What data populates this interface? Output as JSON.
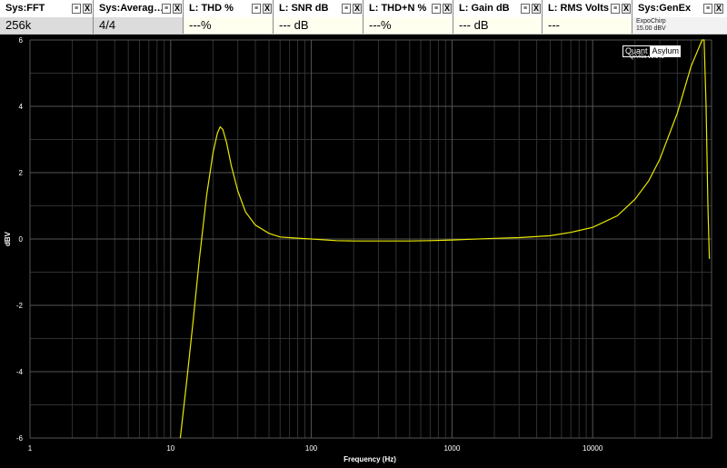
{
  "meters": [
    {
      "title": "Sys:FFT",
      "value": "256k",
      "kind": "sys"
    },
    {
      "title": "Sys:Averag…",
      "value": "4/4",
      "kind": "sys"
    },
    {
      "title": "L: THD %",
      "value": "---%",
      "kind": "lvl"
    },
    {
      "title": "L: SNR dB",
      "value": "--- dB",
      "kind": "lvl"
    },
    {
      "title": "L: THD+N %",
      "value": "---%",
      "kind": "lvl"
    },
    {
      "title": "L: Gain dB",
      "value": "--- dB",
      "kind": "lvl"
    },
    {
      "title": "L: RMS Volts",
      "value": "---",
      "kind": "lvl"
    }
  ],
  "generator": {
    "title": "Sys:GenEx",
    "line1": "ExpoChirp",
    "line2": "15.00 dBV"
  },
  "menu_glyph": "≡",
  "close_glyph": "X",
  "logo": {
    "part1": "Quant",
    "part2": "Asylum",
    "version": "QA40x v1.142"
  },
  "colors": {
    "trace": "#e8e800",
    "grid": "#555555",
    "grid_minor": "#303030",
    "axis_text": "#ffffff"
  },
  "chart_data": {
    "type": "line",
    "xlabel": "Frequency (Hz)",
    "ylabel": "dBV",
    "x_scale": "log",
    "xlim": [
      1,
      70000
    ],
    "ylim": [
      -6,
      6
    ],
    "x_ticks": [
      "1",
      "10",
      "100",
      "1000",
      "10000"
    ],
    "y_ticks": [
      "6",
      "4",
      "2",
      "0",
      "-2",
      "-4",
      "-6"
    ],
    "grid": true,
    "series": [
      {
        "x": [
          11.7,
          13,
          14.5,
          16,
          18,
          20,
          21.5,
          22.5,
          23.5,
          25,
          27,
          30,
          34,
          40,
          50,
          60,
          75,
          90,
          100,
          150,
          200,
          300,
          500,
          700,
          1000,
          2000,
          3000,
          5000,
          7000,
          10000,
          15000,
          20000,
          25000,
          30000,
          40000,
          50000,
          60000,
          62000,
          64000,
          66000,
          67500
        ],
        "y": [
          -6,
          -4.3,
          -2.4,
          -0.6,
          1.3,
          2.6,
          3.2,
          3.38,
          3.3,
          2.9,
          2.2,
          1.45,
          0.82,
          0.42,
          0.17,
          0.06,
          0.03,
          0.01,
          0.0,
          -0.05,
          -0.06,
          -0.06,
          -0.06,
          -0.05,
          -0.03,
          0.02,
          0.04,
          0.1,
          0.2,
          0.35,
          0.7,
          1.2,
          1.75,
          2.4,
          3.8,
          5.2,
          6,
          6,
          4,
          1,
          -0.6
        ]
      }
    ]
  }
}
